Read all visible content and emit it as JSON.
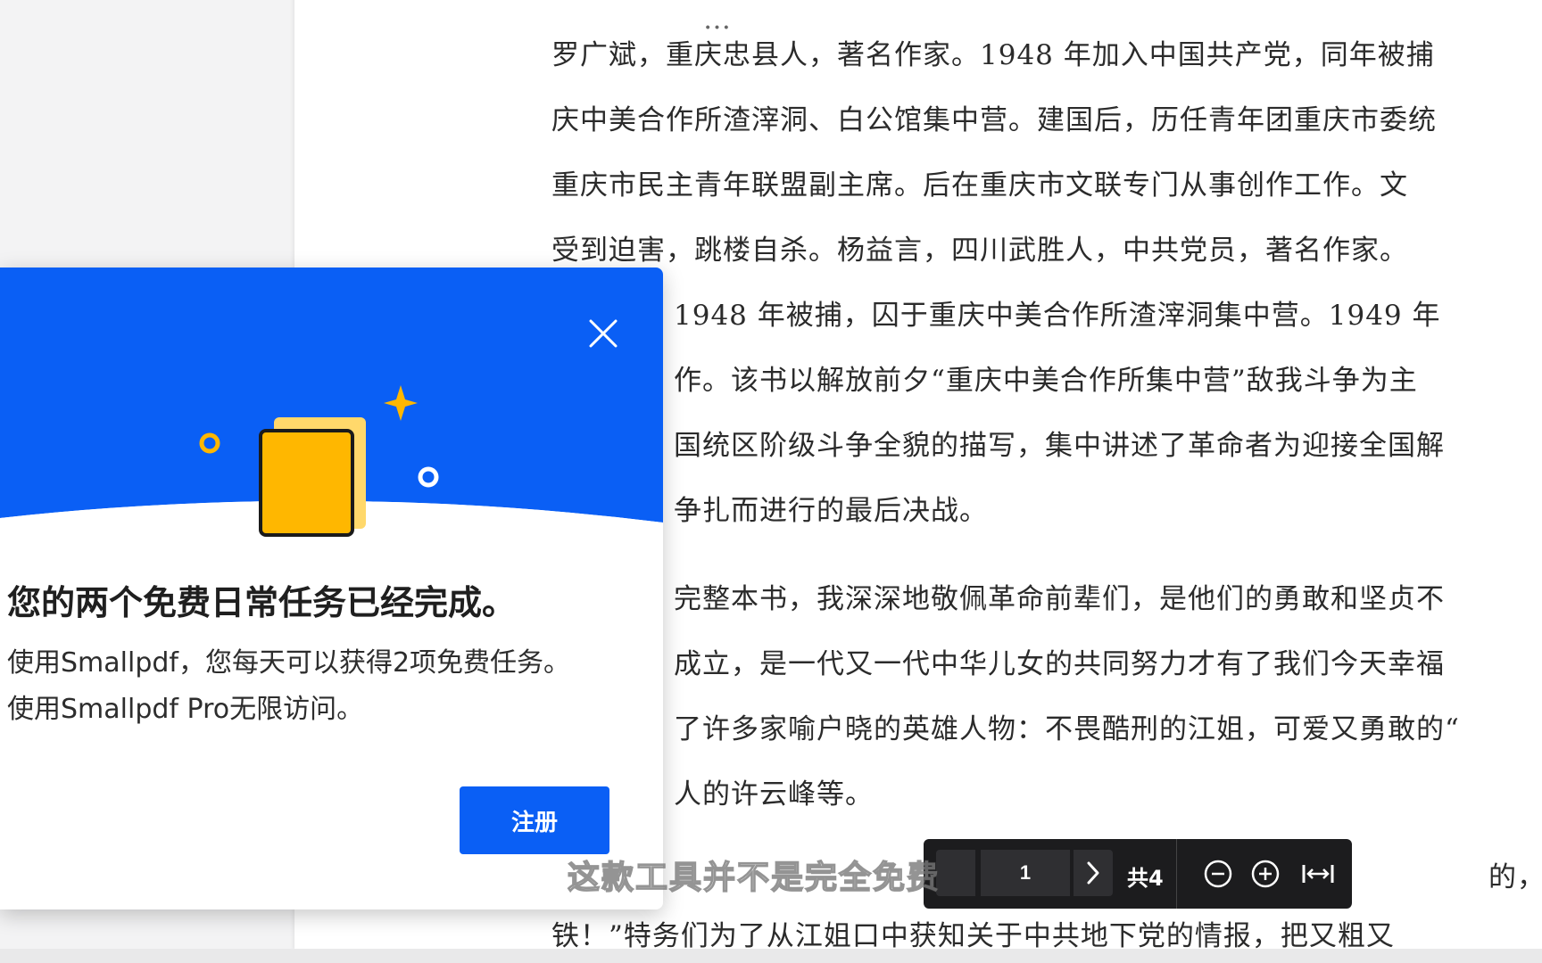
{
  "document": {
    "lines": [
      "罗广斌，重庆忠县人，著名作家。1948 年加入中国共产党，同年被捕",
      "庆中美合作所渣滓洞、白公馆集中营。建国后，历任青年团重庆市委统",
      "重庆市民主青年联盟副主席。后在重庆市文联专门从事创作工作。文",
      "受到迫害，跳楼自杀。杨益言，四川武胜人，中共党员，著名作家。",
      "1948 年被捕，囚于重庆中美合作所渣滓洞集中营。1949 年",
      "作。该书以解放前夕“重庆中美合作所集中营”敌我斗争为主",
      "国统区阶级斗争全貌的描写，集中讲述了革命者为迎接全国解",
      "争扎而进行的最后决战。",
      "完整本书，我深深地敬佩革命前辈们，是他们的勇敢和坚贞不",
      "成立，是一代又一代中华儿女的共同努力才有了我们今天幸福",
      "了许多家喻户晓的英雄人物：不畏酷刑的江姐，可爱又勇敢的“",
      "人的许云峰等。",
      "的，共产党人的",
      "铁！”特务们为了从江姐口中获知关于中共地下党的情报，把又粗又"
    ]
  },
  "dialog": {
    "title": "您的两个免费日常任务已经完成。",
    "body": "使用Smallpdf，您每天可以获得2项免费任务。使用Smallpdf Pro无限访问。",
    "signup_label": "注册",
    "colors": {
      "hero": "#0a5ff5",
      "doc_yellow": "#ffb700",
      "doc_back": "#ffd86b"
    }
  },
  "toolbar": {
    "page_value": "1",
    "total": "共4",
    "icons": [
      "chevron-right-icon",
      "zoom-out-icon",
      "zoom-in-icon",
      "fit-width-icon"
    ]
  },
  "subtitle": "这款工具并不是完全免费"
}
